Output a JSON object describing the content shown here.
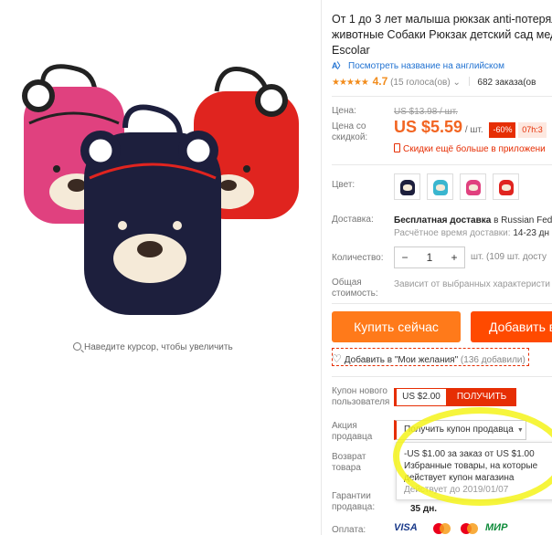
{
  "gallery": {
    "zoom_hint": "Наведите курсор, чтобы увеличить",
    "colors": {
      "pink": "#e0417f",
      "navy": "#1d1f3d",
      "red": "#e0241f",
      "face": "#f5ead8",
      "nose": "#3a2a22"
    }
  },
  "product": {
    "title_lines": [
      "От 1 до 3 лет малыша рюкзак anti-потерял",
      "животные Собаки Рюкзак детский сад мед",
      "Escolar"
    ],
    "translate_link": "Посмотреть название на английском",
    "rating": {
      "stars": "★★★★★",
      "score": "4.7",
      "votes": "(15 голоса(ов)",
      "orders": "682 заказа(ов"
    },
    "price": {
      "label": "Цена:",
      "old": "US $13.98 / шт.",
      "discount_label_1": "Цена со",
      "discount_label_2": "скидкой:",
      "new": "US $5.59",
      "unit": "/ шт.",
      "discount": "-60%",
      "timer": "07h:3",
      "mobile_note": "Скидки ещё больше в приложени"
    },
    "color": {
      "label": "Цвет:",
      "swatches": [
        {
          "name": "navy",
          "color": "#1d1f3d"
        },
        {
          "name": "teal",
          "color": "#3ab6cf"
        },
        {
          "name": "pink",
          "color": "#e0417f"
        },
        {
          "name": "red",
          "color": "#e0241f"
        }
      ]
    },
    "shipping": {
      "label": "Доставка:",
      "line1_bold": "Бесплатная доставка",
      "line1_rest": "в Russian Fede",
      "line2_grey": "Расчётное время доставки:",
      "line2_rest": "14-23 дн"
    },
    "quantity": {
      "label": "Количество:",
      "minus": "−",
      "value": "1",
      "plus": "+",
      "note": "шт. (109 шт. досту"
    },
    "total": {
      "label_1": "Общая",
      "label_2": "стоимость:",
      "value": "Зависит от выбранных характеристи"
    },
    "buy_now": "Купить сейчас",
    "add_to_cart": "Добавить в",
    "wishlist": {
      "text": "Добавить в \"Мои желания\"",
      "count": "(136 добавили)"
    },
    "new_user_coupon": {
      "label_1": "Купон нового",
      "label_2": "пользователя",
      "amount": "US $2.00",
      "button": "ПОЛУЧИТЬ"
    },
    "seller_promo": {
      "label_1": "Акция",
      "label_2": "продавца",
      "button": "Получить купон продавца",
      "popup_line1": "-US $1.00 за заказ от US $1.00",
      "popup_line2": "Избранные товары, на которые",
      "popup_line3": "действует купон магазина",
      "popup_expiry": "Действует до 2019/01/07"
    },
    "returns": {
      "label_1": "Возврат",
      "label_2": "товара"
    },
    "guarantee": {
      "label_1": "Гарантии",
      "label_2": "продавца:",
      "days": "35 дн."
    },
    "payment": {
      "label": "Оплата:",
      "methods": [
        "VISA",
        "MasterCard",
        "Maestro",
        "МИР"
      ]
    }
  }
}
